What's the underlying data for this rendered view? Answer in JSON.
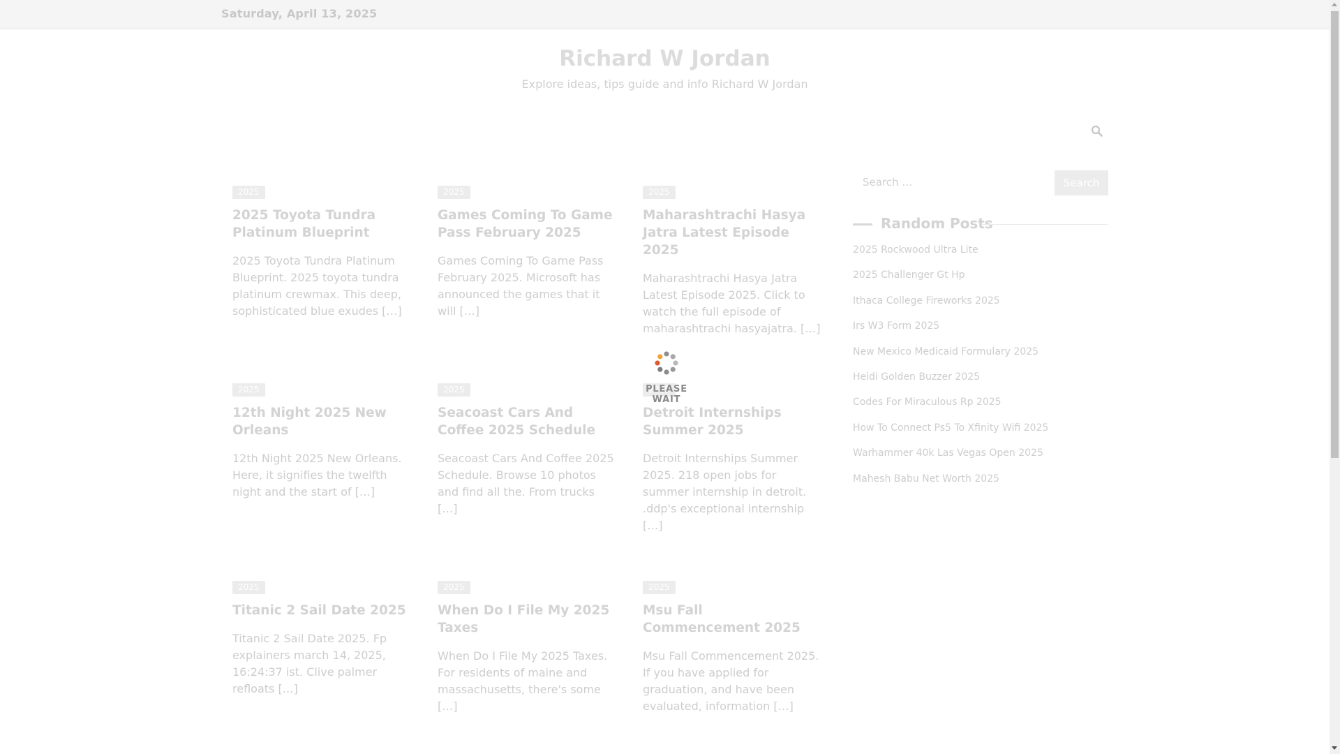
{
  "topbar": {
    "date": "Saturday, April 13, 2025"
  },
  "site": {
    "title": "Richard W Jordan",
    "tagline": "Explore ideas, tips guide and info Richard W Jordan"
  },
  "posts": [
    {
      "category": "2025",
      "title": "2025 Toyota Tundra Platinum Blueprint",
      "excerpt": "2025 Toyota Tundra Platinum Blueprint. 2025 toyota tundra platinum crewmax. This deep, sophisticated blue exudes […]"
    },
    {
      "category": "2025",
      "title": "Games Coming To Game Pass February 2025",
      "excerpt": "Games Coming To Game Pass February 2025. Microsoft has announced the games that it will […]"
    },
    {
      "category": "2025",
      "title": "Maharashtrachi Hasya Jatra Latest Episode 2025",
      "excerpt": "Maharashtrachi Hasya Jatra Latest Episode 2025. Click to watch the full episode of maharashtrachi hasyajatra. […]"
    },
    {
      "category": "2025",
      "title": "12th Night 2025 New Orleans",
      "excerpt": "12th Night 2025 New Orleans. Here, it signifies the twelfth night and the start of […]"
    },
    {
      "category": "2025",
      "title": "Seacoast Cars And Coffee 2025 Schedule",
      "excerpt": "Seacoast Cars And Coffee 2025 Schedule. Browse 10 photos and find all the. From trucks […]"
    },
    {
      "category": "2025",
      "title": "Detroit Internships Summer 2025",
      "excerpt": "Detroit Internships Summer 2025. 218 open jobs for summer internship in detroit. .ddp's exceptional internship […]"
    },
    {
      "category": "2025",
      "title": "Titanic 2 Sail Date 2025",
      "excerpt": "Titanic 2 Sail Date 2025. Fp explainers march 14, 2025, 16:24:37 ist. Clive palmer refloats […]"
    },
    {
      "category": "2025",
      "title": "When Do I File My 2025 Taxes",
      "excerpt": "When Do I File My 2025 Taxes. For residents of maine and massachusetts, there's some […]"
    },
    {
      "category": "2025",
      "title": "Msu Fall Commencement 2025",
      "excerpt": "Msu Fall Commencement 2025. If you have applied for graduation, and have been evaluated, information […]"
    }
  ],
  "loader": {
    "label": "PLEASE WAIT"
  },
  "sidebar": {
    "search": {
      "placeholder": "Search …",
      "button": "Search"
    },
    "widget_title": "Random Posts",
    "random_posts": [
      "2025 Rockwood Ultra Lite",
      "2025 Challenger Gt Hp",
      "Ithaca College Fireworks 2025",
      "Irs W3 Form 2025",
      "New Mexico Medicaid Formulary 2025",
      "Heidi Golden Buzzer 2025",
      "Codes For Miraculous Rp 2025",
      "How To Connect Ps5 To Xfinity Wifi 2025",
      "Warhammer 40k Las Vegas Open 2025",
      "Mahesh Babu Net Worth 2025"
    ]
  },
  "icons": {
    "header_search": "search-icon",
    "loader": "spinner-icon"
  },
  "colors": {
    "loader_dots": [
      "#e05a2b",
      "#f2a33a",
      "#7a7a7a",
      "#b5b5b5"
    ]
  }
}
